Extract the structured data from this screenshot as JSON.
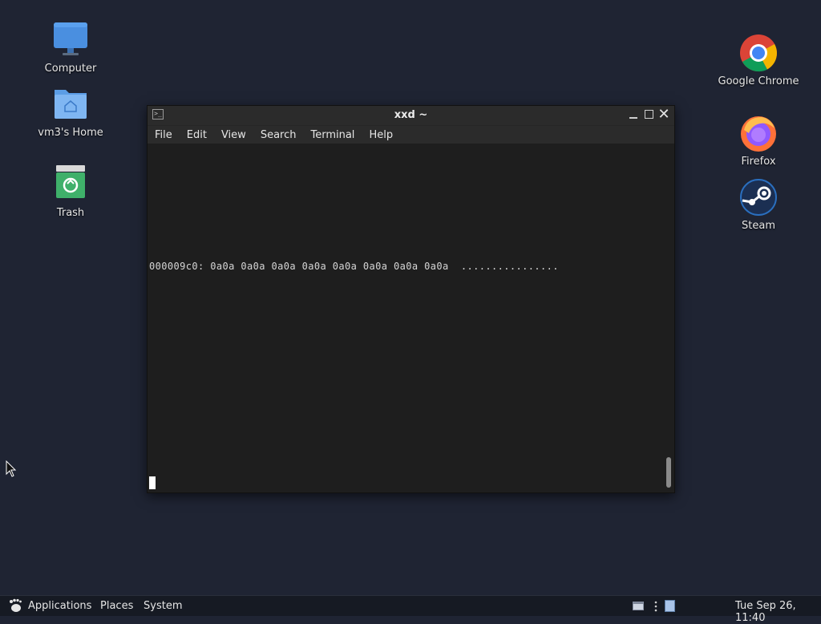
{
  "desktop": {
    "left_icons": [
      {
        "label": "Computer",
        "icon": "computer-icon"
      },
      {
        "label": "vm3's Home",
        "icon": "home-folder-icon"
      },
      {
        "label": "Trash",
        "icon": "trash-icon"
      }
    ],
    "right_icons": [
      {
        "label": "Google Chrome",
        "icon": "chrome-icon"
      },
      {
        "label": "Firefox",
        "icon": "firefox-icon"
      },
      {
        "label": "Steam",
        "icon": "steam-icon"
      }
    ]
  },
  "terminal": {
    "title": "xxd ~",
    "menu": [
      "File",
      "Edit",
      "View",
      "Search",
      "Terminal",
      "Help"
    ],
    "output_line": "000009c0: 0a0a 0a0a 0a0a 0a0a 0a0a 0a0a 0a0a 0a0a  ................"
  },
  "taskbar": {
    "applications_label": "Applications",
    "places_label": "Places",
    "system_label": "System",
    "clock": "Tue Sep 26, 11:40"
  },
  "colors": {
    "desktop_bg": "#1f2433",
    "terminal_bg": "#1e1e1e",
    "taskbar_bg": "#161a23"
  }
}
